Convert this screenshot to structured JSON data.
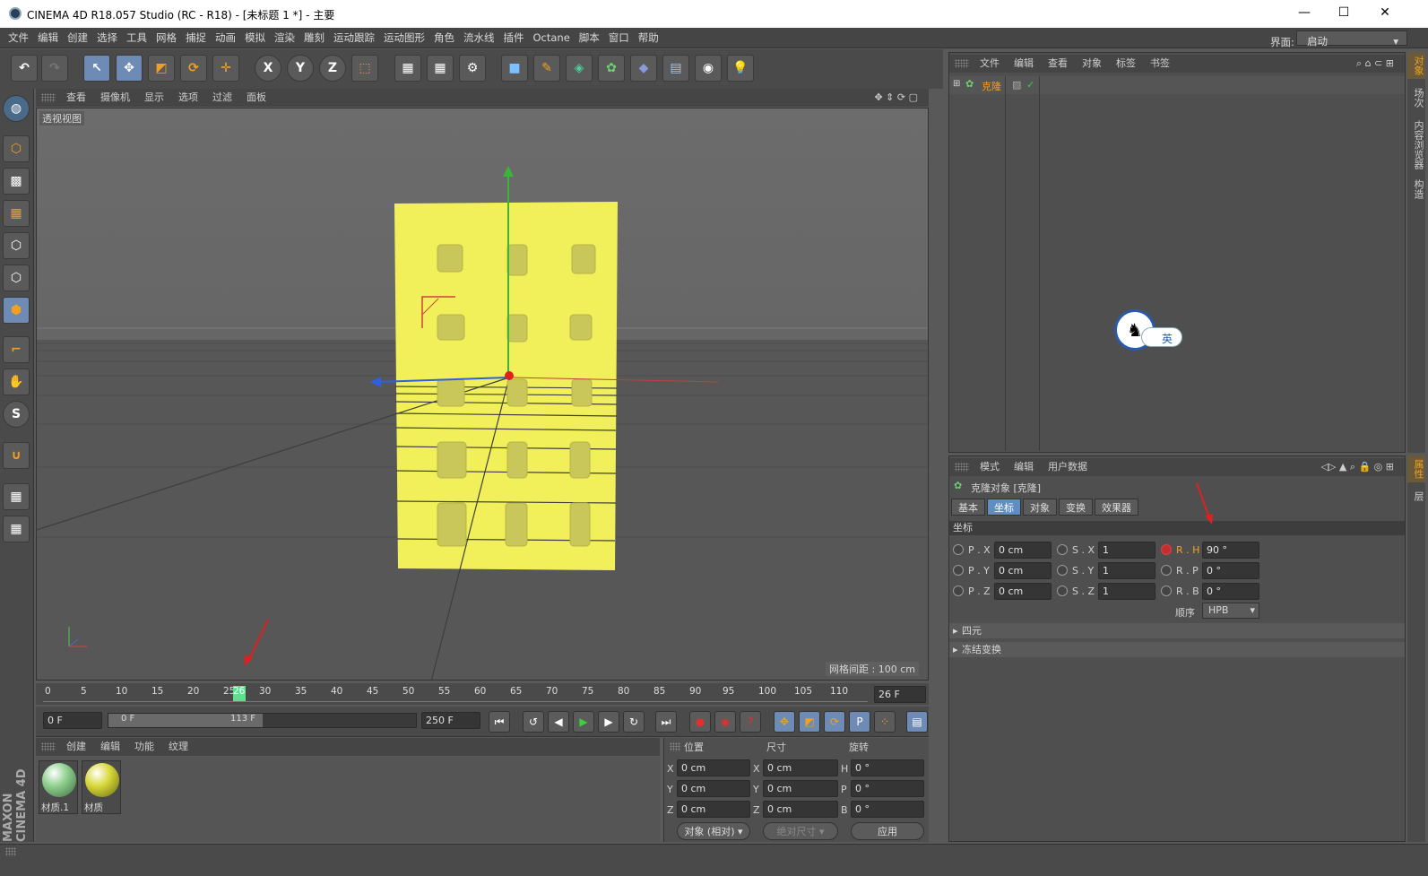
{
  "window": {
    "title": "CINEMA 4D R18.057 Studio (RC - R18) - [未标题 1 *] - 主要",
    "min": "—",
    "max": "☐",
    "close": "✕"
  },
  "menu": [
    "文件",
    "编辑",
    "创建",
    "选择",
    "工具",
    "网格",
    "捕捉",
    "动画",
    "模拟",
    "渲染",
    "雕刻",
    "运动跟踪",
    "运动图形",
    "角色",
    "流水线",
    "插件",
    "Octane",
    "脚本",
    "窗口",
    "帮助"
  ],
  "layout": {
    "label": "界面:",
    "value": "启动"
  },
  "toolbar": {
    "x": "X",
    "y": "Y",
    "z": "Z"
  },
  "viewport": {
    "menu": [
      "查看",
      "摄像机",
      "显示",
      "选项",
      "过滤",
      "面板"
    ],
    "view_name": "透视视图",
    "grid_info": "网格间距 : 100 cm"
  },
  "objmgr": {
    "menu": [
      "文件",
      "编辑",
      "查看",
      "对象",
      "标签",
      "书签"
    ],
    "object": "克隆",
    "ime": "英"
  },
  "right_tabs": [
    "对象",
    "场次",
    "内容浏览器",
    "构造"
  ],
  "attr": {
    "menu": [
      "模式",
      "编辑",
      "用户数据"
    ],
    "title": "克隆对象 [克隆]",
    "tabs": [
      "基本",
      "坐标",
      "对象",
      "变换",
      "效果器"
    ],
    "section": "坐标",
    "px_l": "P . X",
    "px": "0 cm",
    "py_l": "P . Y",
    "py": "0 cm",
    "pz_l": "P . Z",
    "pz": "0 cm",
    "sx_l": "S . X",
    "sx": "1",
    "sy_l": "S . Y",
    "sy": "1",
    "sz_l": "S . Z",
    "sz": "1",
    "rh_l": "R . H",
    "rh": "90 °",
    "rp_l": "R . P",
    "rp": "0 °",
    "rb_l": "R . B",
    "rb": "0 °",
    "order_l": "顺序",
    "order": "HPB",
    "quat": "四元",
    "freeze": "冻结变换"
  },
  "attr_side_tabs": [
    "属性",
    "层"
  ],
  "timeline": {
    "ticks": [
      "0",
      "5",
      "10",
      "15",
      "20",
      "25",
      "26",
      "30",
      "35",
      "40",
      "45",
      "50",
      "55",
      "60",
      "65",
      "70",
      "75",
      "80",
      "85",
      "90",
      "95",
      "100",
      "105",
      "110"
    ],
    "current": "26 F",
    "start": "0 F",
    "range_start": "0 F",
    "range_end": "113 F",
    "end": "250 F"
  },
  "matmgr": {
    "menu": [
      "创建",
      "编辑",
      "功能",
      "纹理"
    ],
    "materials": [
      {
        "name": "材质.1",
        "color": "#8fd08f"
      },
      {
        "name": "材质",
        "color": "#d8d83a"
      }
    ]
  },
  "coords": {
    "headers": [
      "位置",
      "尺寸",
      "旋转"
    ],
    "rows": [
      {
        "a": "X",
        "pos": "0 cm",
        "b": "X",
        "size": "0 cm",
        "c": "H",
        "rot": "0 °"
      },
      {
        "a": "Y",
        "pos": "0 cm",
        "b": "Y",
        "size": "0 cm",
        "c": "P",
        "rot": "0 °"
      },
      {
        "a": "Z",
        "pos": "0 cm",
        "b": "Z",
        "size": "0 cm",
        "c": "B",
        "rot": "0 °"
      }
    ],
    "mode": "对象 (相对)",
    "size_mode": "绝对尺寸",
    "apply": "应用"
  },
  "brand": "MAXON CINEMA 4D",
  "colors": {
    "plane": "#f2f05a",
    "accent": "#5f8fc2",
    "arrow": "#e02020"
  }
}
